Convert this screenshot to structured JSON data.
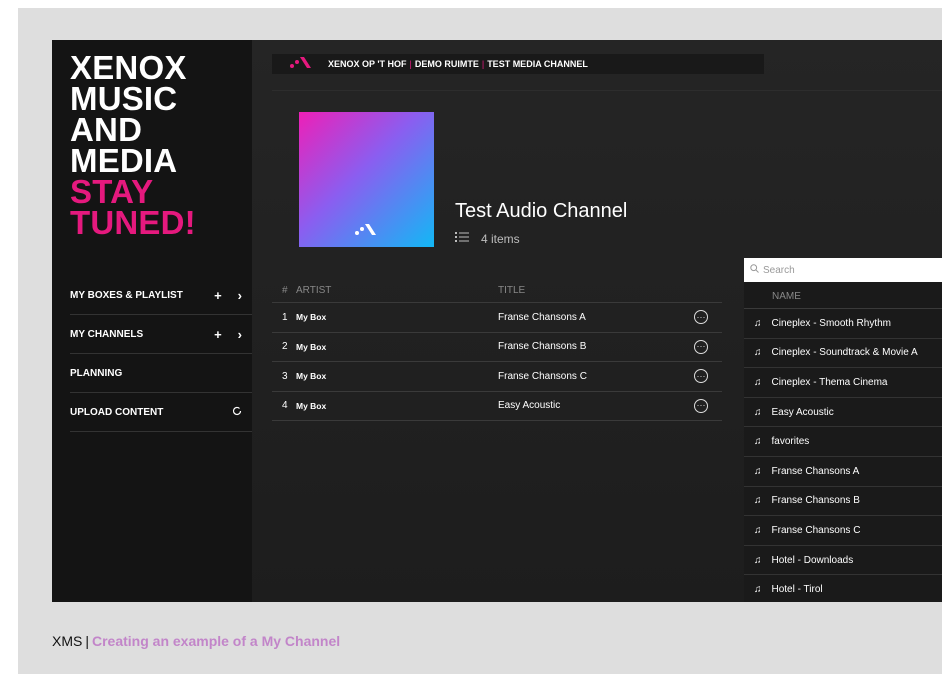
{
  "brand": {
    "lines_white": [
      "XENOX",
      "MUSIC",
      "AND",
      "MEDIA"
    ],
    "lines_pink": [
      "STAY",
      "TUNED!"
    ]
  },
  "sidebar": {
    "items": [
      {
        "label": "MY BOXES & PLAYLIST",
        "add": "+",
        "arrow": "›"
      },
      {
        "label": "MY CHANNELS",
        "add": "+",
        "arrow": "›"
      },
      {
        "label": "PLANNING"
      },
      {
        "label": "UPLOAD CONTENT",
        "icon": "refresh-icon"
      }
    ]
  },
  "breadcrumb": {
    "parts": [
      "XENOX OP 'T HOF",
      "DEMO RUIMTE",
      "TEST MEDIA CHANNEL"
    ],
    "separator": "|"
  },
  "channel": {
    "title": "Test Audio Channel",
    "items_count": "4 items"
  },
  "tracks": {
    "headers": {
      "num": "#",
      "artist": "ARTIST",
      "title": "TITLE"
    },
    "rows": [
      {
        "num": "1",
        "artist": "My Box",
        "title": "Franse Chansons A"
      },
      {
        "num": "2",
        "artist": "My Box",
        "title": "Franse Chansons B"
      },
      {
        "num": "3",
        "artist": "My Box",
        "title": "Franse Chansons C"
      },
      {
        "num": "4",
        "artist": "My Box",
        "title": "Easy Acoustic"
      }
    ]
  },
  "library": {
    "search_placeholder": "Search",
    "header": "NAME",
    "items": [
      "Cineplex - Smooth Rhythm",
      "Cineplex - Soundtrack & Movie A",
      "Cineplex - Thema Cinema",
      "Easy Acoustic",
      "favorites",
      "Franse Chansons A",
      "Franse Chansons B",
      "Franse Chansons C",
      "Hotel - Downloads",
      "Hotel - Tirol"
    ]
  },
  "caption": {
    "prefix": "XMS",
    "separator": "|",
    "text": "Creating an example of a My Channel"
  },
  "colors": {
    "accent": "#e5197e",
    "caption_text": "#c285c9"
  }
}
